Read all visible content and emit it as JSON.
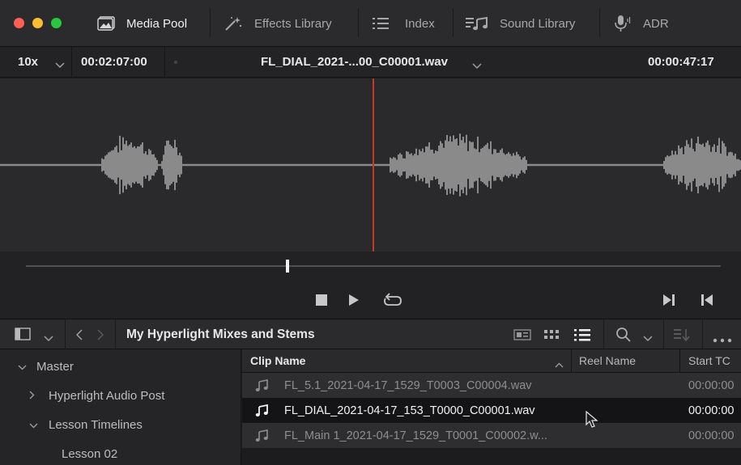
{
  "colors": {
    "red_light": "#ff5f57",
    "yellow_light": "#febc2e",
    "green_light": "#28c840",
    "playhead": "#c0392b",
    "waveform": "#8a8a8a"
  },
  "tabs": [
    {
      "label": "Media Pool",
      "icon": "media-pool-icon",
      "active": true
    },
    {
      "label": "Effects Library",
      "icon": "magic-wand-icon",
      "active": false
    },
    {
      "label": "Index",
      "icon": "list-icon",
      "active": false
    },
    {
      "label": "Sound Library",
      "icon": "sound-library-icon",
      "active": false
    },
    {
      "label": "ADR",
      "icon": "microphone-icon",
      "active": false
    }
  ],
  "viewer": {
    "zoom": "10x",
    "duration": "00:02:07:00",
    "clip_title": "FL_DIAL_2021-...00_C00001.wav",
    "timecode": "00:00:47:17"
  },
  "transport": {
    "stop": "stop-icon",
    "play": "play-icon",
    "loop": "loop-icon",
    "next": "next-icon",
    "prev": "previous-icon"
  },
  "browser": {
    "bin_title": "My Hyperlight Mixes and Stems"
  },
  "sidebar": {
    "items": [
      {
        "label": "Master",
        "level": 0,
        "expanded": true
      },
      {
        "label": "Hyperlight Audio Post",
        "level": 1,
        "expanded": false
      },
      {
        "label": "Lesson Timelines",
        "level": 1,
        "expanded": true
      },
      {
        "label": "Lesson 02",
        "level": 2,
        "expanded": false
      }
    ]
  },
  "columns": {
    "clip_name": "Clip Name",
    "reel_name": "Reel Name",
    "start_tc": "Start TC"
  },
  "clips": [
    {
      "name": "FL_5.1_2021-04-17_1529_T0003_C00004.wav",
      "start_tc": "00:00:00",
      "selected": false
    },
    {
      "name": "FL_DIAL_2021-04-17_153_T0000_C00001.wav",
      "start_tc": "00:00:00",
      "selected": true
    },
    {
      "name": "FL_Main 1_2021-04-17_1529_T0001_C00002.w...",
      "start_tc": "00:00:00",
      "selected": false
    }
  ]
}
